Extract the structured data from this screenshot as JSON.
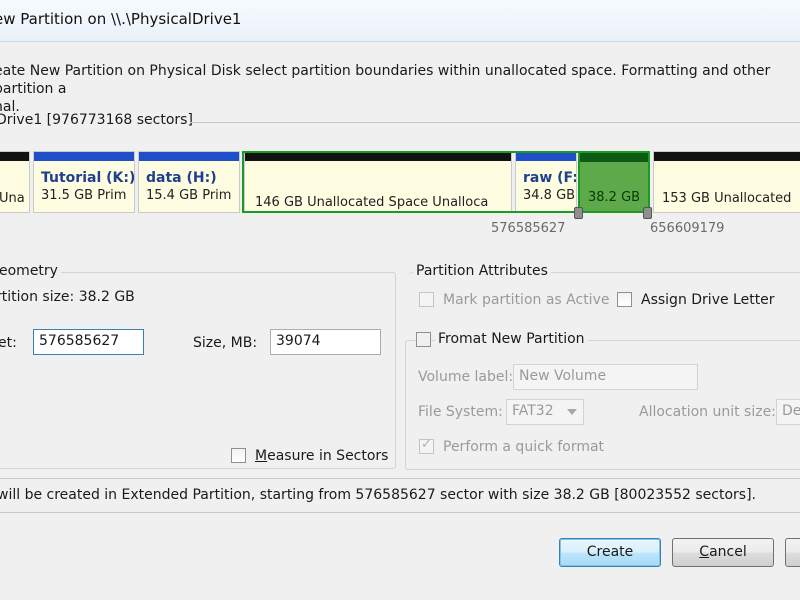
{
  "window": {
    "title": "ew Partition on \\\\.\\PhysicalDrive1"
  },
  "instruction": "eate New Partition on Physical Disk select partition boundaries within unallocated space. Formatting and other partition a nal.",
  "instruction_line1": "eate New Partition on Physical Disk select partition boundaries within unallocated space. Formatting and other partition a",
  "instruction_line2": "nal.",
  "disk": {
    "label": "Drive1 [976773168 sectors]"
  },
  "partitions": [
    {
      "name": "",
      "size": "Una"
    },
    {
      "name": "Tutorial (K:)",
      "size": "31.5 GB Prim"
    },
    {
      "name": "data (H:)",
      "size": "15.4 GB Prim"
    },
    {
      "label": "146 GB Unallocated Space Unalloca"
    },
    {
      "name": "raw (F:",
      "size": "34.8 GB"
    },
    {
      "size": "38.2 GB"
    },
    {
      "label": "153 GB Unallocated"
    }
  ],
  "boundaries": {
    "start": "576585627",
    "end": "656609179"
  },
  "geometry": {
    "title": "eometry",
    "partition_size": "rtition size: 38.2 GB",
    "offset_label": "et:",
    "offset_value": "576585627",
    "size_label": "Size, MB:",
    "size_value": "39074",
    "measure_sectors": "Measure in Sectors",
    "measure_checked": false
  },
  "attributes": {
    "title": "Partition Attributes",
    "mark_active": "Mark partition as Active",
    "assign_letter": "Assign Drive Letter",
    "format_new": "Fromat New Partition",
    "volume_label": "Volume label:",
    "volume_value": "New Volume",
    "file_system_label": "File System:",
    "file_system_value": "FAT32",
    "alloc_label": "Allocation unit size:",
    "alloc_value": "De",
    "quick_format": "Perform a quick format"
  },
  "status": " will be created in Extended Partition, starting from 576585627 sector with size 38.2 GB [80023552 sectors].",
  "buttons": {
    "create": "Create",
    "cancel": "Cancel"
  },
  "colors": {
    "accent_green": "#1a9b23",
    "selected_fill": "#5ea94a",
    "partition_bar_blue": "#1f4fc8",
    "partition_fill": "#fefde2"
  }
}
